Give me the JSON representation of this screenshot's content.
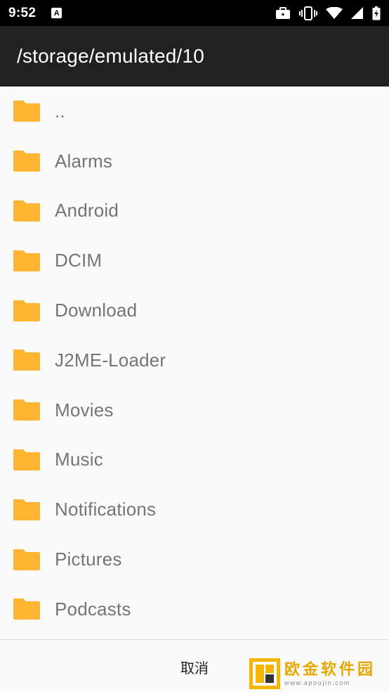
{
  "status_bar": {
    "time": "9:52",
    "notification_glyph": "A",
    "icons": [
      "briefcase-icon",
      "vibrate-icon",
      "wifi-icon",
      "signal-icon",
      "battery-icon"
    ]
  },
  "app_bar": {
    "title": "/storage/emulated/10"
  },
  "list": {
    "items": [
      {
        "label": "..",
        "icon": "folder-icon"
      },
      {
        "label": "Alarms",
        "icon": "folder-icon"
      },
      {
        "label": "Android",
        "icon": "folder-icon"
      },
      {
        "label": "DCIM",
        "icon": "folder-icon"
      },
      {
        "label": "Download",
        "icon": "folder-icon"
      },
      {
        "label": "J2ME-Loader",
        "icon": "folder-icon"
      },
      {
        "label": "Movies",
        "icon": "folder-icon"
      },
      {
        "label": "Music",
        "icon": "folder-icon"
      },
      {
        "label": "Notifications",
        "icon": "folder-icon"
      },
      {
        "label": "Pictures",
        "icon": "folder-icon"
      },
      {
        "label": "Podcasts",
        "icon": "folder-icon"
      }
    ]
  },
  "bottom_bar": {
    "cancel_label": "取消"
  },
  "watermark": {
    "name": "欧金软件园",
    "url": "www.apoujin.com"
  },
  "colors": {
    "folder": "#FFB531",
    "app_bar": "#212121",
    "status_bar": "#000000",
    "background": "#FAFAFA",
    "item_text": "#757575"
  }
}
